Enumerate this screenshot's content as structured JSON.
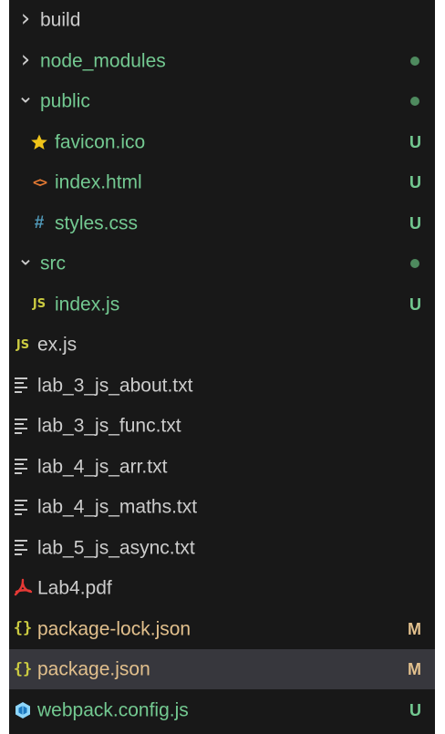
{
  "colors": {
    "background": "#181818",
    "selected_row": "#37373d",
    "untracked": "#73c991",
    "modified": "#e2c08d",
    "default_text": "#cccccc",
    "dot": "#4e8a5e",
    "favicon": "#f0c419",
    "html": "#e37933",
    "css": "#519aba",
    "js": "#cbcb41",
    "json": "#cbcb41",
    "pdf": "#e53935",
    "webpack": "#8ed6fb"
  },
  "tree": [
    {
      "label": "build",
      "kind": "folder",
      "expanded": false,
      "depth": 0,
      "status": ""
    },
    {
      "label": "node_modules",
      "kind": "folder",
      "expanded": false,
      "depth": 0,
      "status": "dot"
    },
    {
      "label": "public",
      "kind": "folder",
      "expanded": true,
      "depth": 0,
      "status": "dot"
    },
    {
      "label": "favicon.ico",
      "kind": "file",
      "icon": "star-icon",
      "depth": 1,
      "status": "U"
    },
    {
      "label": "index.html",
      "kind": "file",
      "icon": "html-code-icon",
      "depth": 1,
      "status": "U"
    },
    {
      "label": "styles.css",
      "kind": "file",
      "icon": "css-hash-icon",
      "depth": 1,
      "status": "U"
    },
    {
      "label": "src",
      "kind": "folder",
      "expanded": true,
      "depth": 0,
      "status": "dot"
    },
    {
      "label": "index.js",
      "kind": "file",
      "icon": "js-file-icon",
      "depth": 1,
      "status": "U"
    },
    {
      "label": "ex.js",
      "kind": "file",
      "icon": "js-file-icon",
      "depth": 0,
      "status": ""
    },
    {
      "label": "lab_3_js_about.txt",
      "kind": "file",
      "icon": "text-file-icon",
      "depth": 0,
      "status": ""
    },
    {
      "label": "lab_3_js_func.txt",
      "kind": "file",
      "icon": "text-file-icon",
      "depth": 0,
      "status": ""
    },
    {
      "label": "lab_4_js_arr.txt",
      "kind": "file",
      "icon": "text-file-icon",
      "depth": 0,
      "status": ""
    },
    {
      "label": "lab_4_js_maths.txt",
      "kind": "file",
      "icon": "text-file-icon",
      "depth": 0,
      "status": ""
    },
    {
      "label": "lab_5_js_async.txt",
      "kind": "file",
      "icon": "text-file-icon",
      "depth": 0,
      "status": ""
    },
    {
      "label": "Lab4.pdf",
      "kind": "file",
      "icon": "pdf-icon",
      "depth": 0,
      "status": ""
    },
    {
      "label": "package-lock.json",
      "kind": "file",
      "icon": "json-braces-icon",
      "depth": 0,
      "status": "M"
    },
    {
      "label": "package.json",
      "kind": "file",
      "icon": "json-braces-icon",
      "depth": 0,
      "status": "M",
      "selected": true
    },
    {
      "label": "webpack.config.js",
      "kind": "file",
      "icon": "webpack-icon",
      "depth": 0,
      "status": "U"
    }
  ],
  "icon_glyphs": {
    "js": "JS",
    "json": "{}",
    "css": "#",
    "html": "<>",
    "chevron_right": "›",
    "chevron_down": "⌄"
  }
}
